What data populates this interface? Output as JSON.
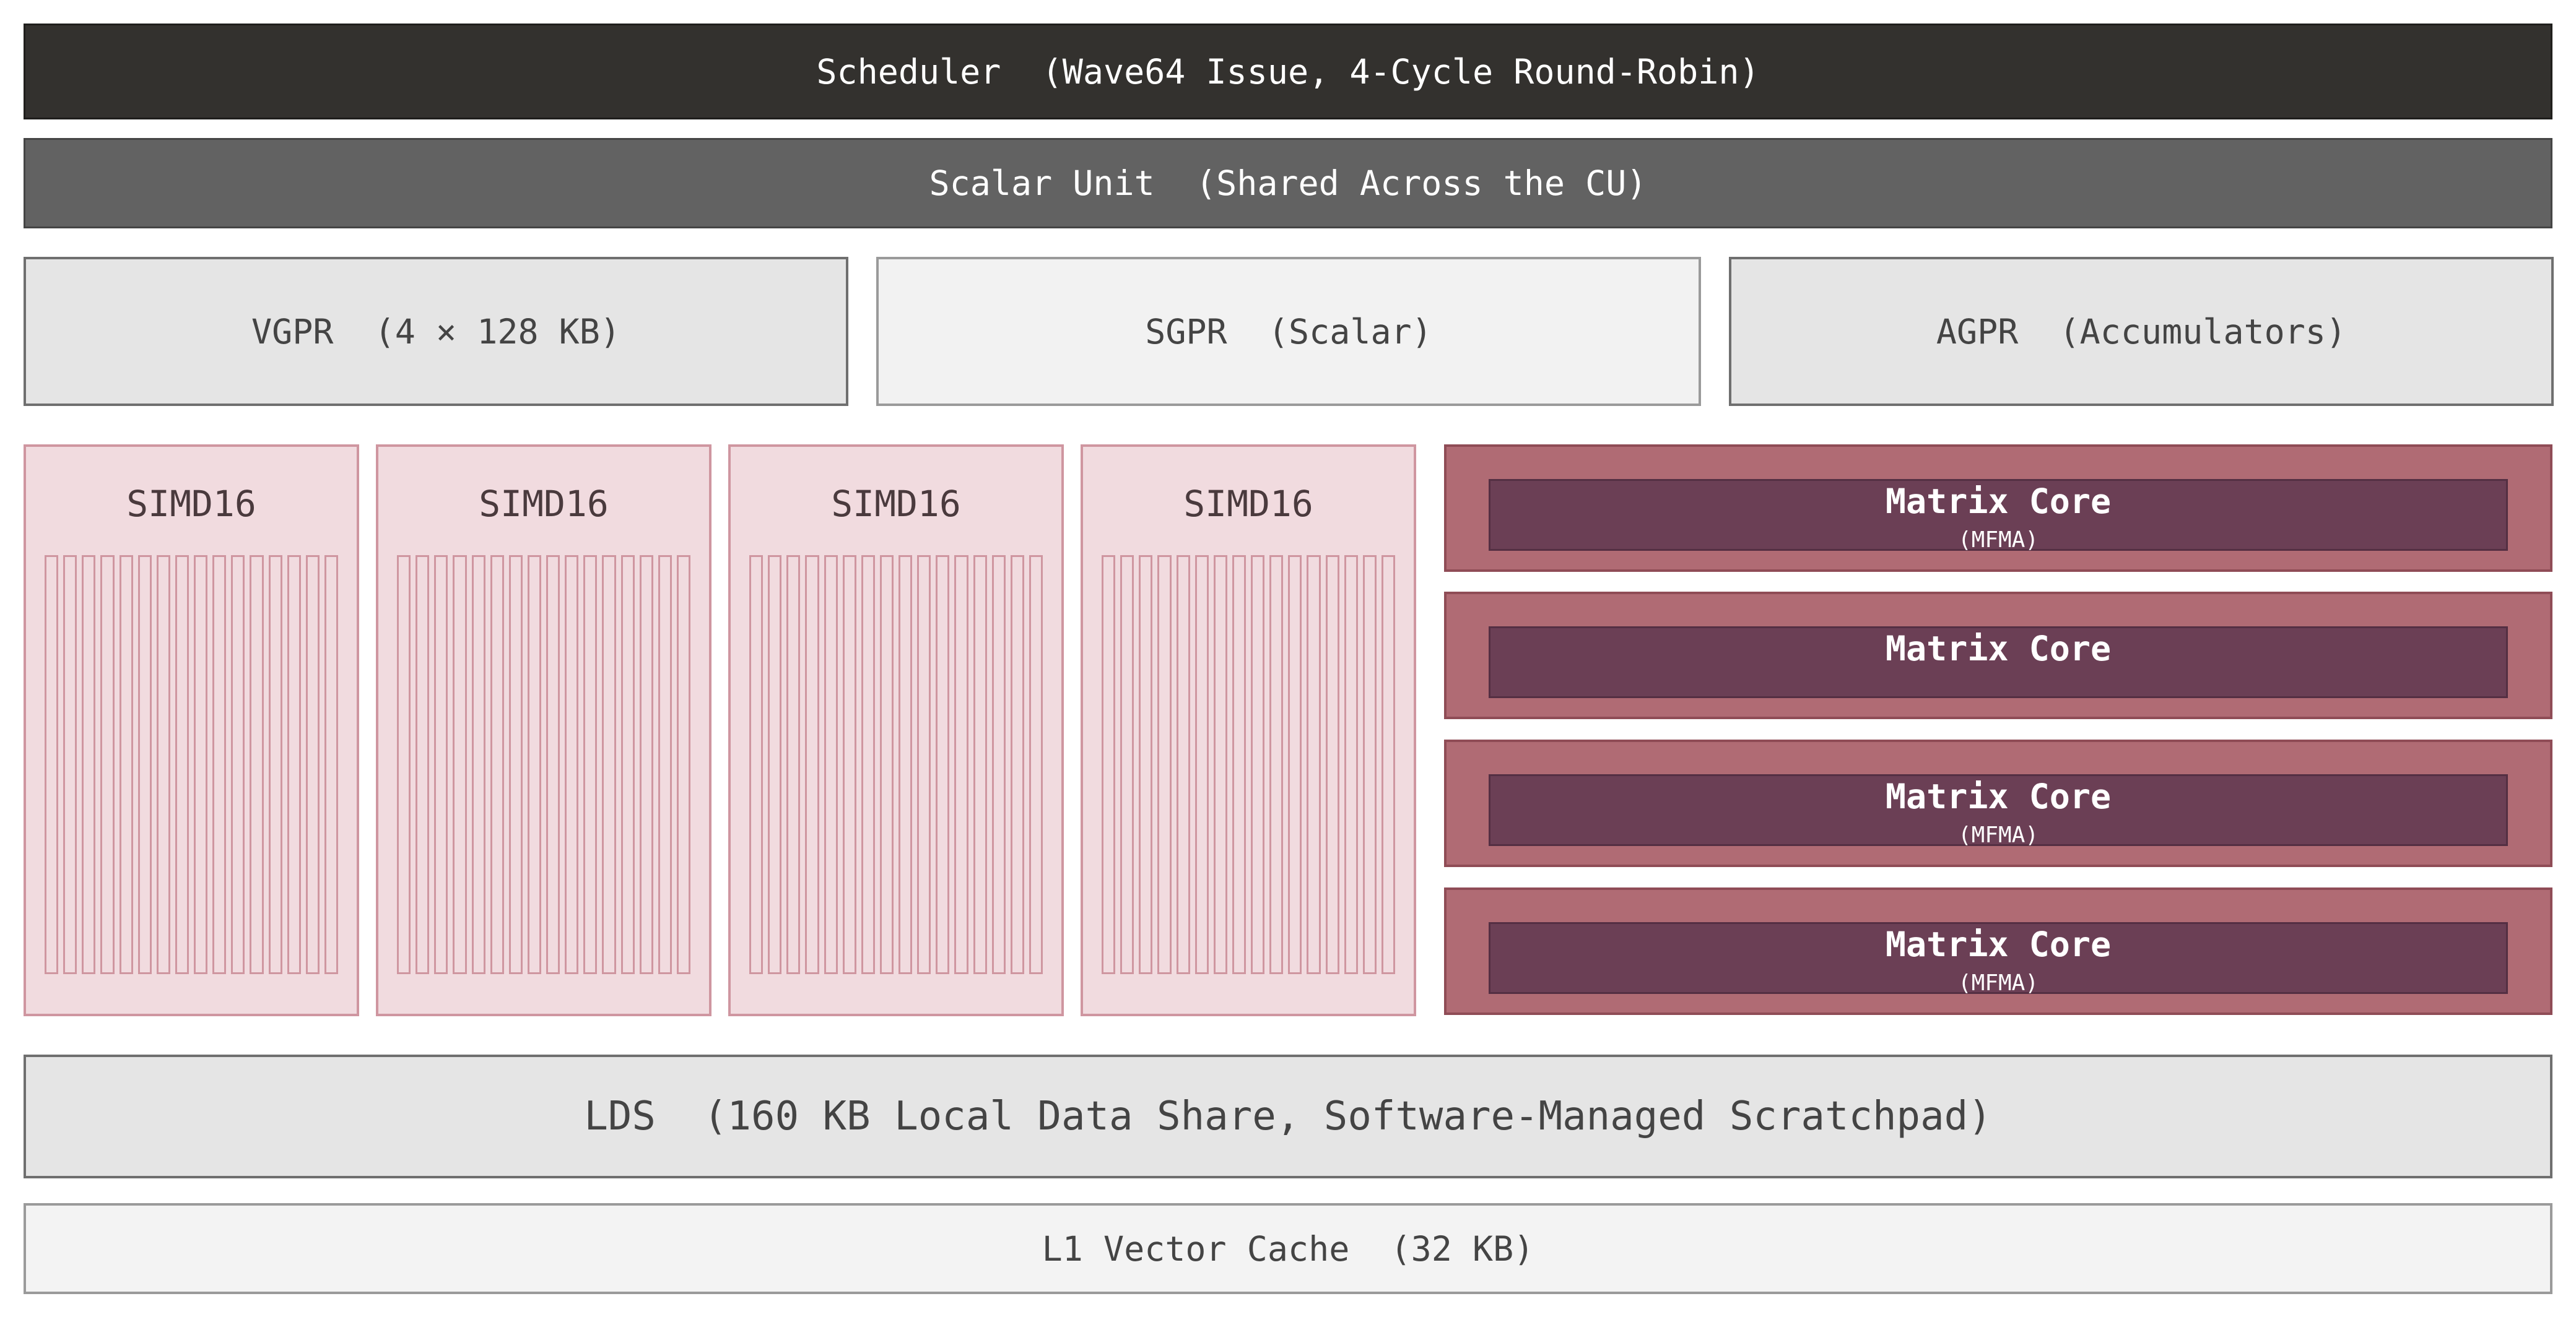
{
  "scheduler": {
    "label": "Scheduler  (Wave64 Issue, 4-Cycle Round-Robin)"
  },
  "scalar_unit": {
    "label": "Scalar Unit  (Shared Across the CU)"
  },
  "registers": {
    "vgpr": "VGPR  (4 × 128 KB)",
    "sgpr": "SGPR  (Scalar)",
    "agpr": "AGPR  (Accumulators)"
  },
  "simd": {
    "units": [
      {
        "label": "SIMD16"
      },
      {
        "label": "SIMD16"
      },
      {
        "label": "SIMD16"
      },
      {
        "label": "SIMD16"
      }
    ],
    "lanes_per_unit": 16
  },
  "matrix_cores": [
    {
      "label": "Matrix Core",
      "sub": "(MFMA)"
    },
    {
      "label": "Matrix Core",
      "sub": ""
    },
    {
      "label": "Matrix Core",
      "sub": "(MFMA)"
    },
    {
      "label": "Matrix Core",
      "sub": "(MFMA)"
    }
  ],
  "lds": {
    "label": "LDS  (160 KB Local Data Share, Software-Managed Scratchpad)"
  },
  "l1_cache": {
    "label": "L1 Vector Cache  (32 KB)"
  },
  "colors": {
    "scheduler": "#33312e",
    "scalar_unit": "#626262",
    "simd_fill": "#f1dbdf",
    "simd_stroke": "#cf96a0",
    "matrix_outer": "#b06b74",
    "matrix_inner": "#6b3f55"
  }
}
